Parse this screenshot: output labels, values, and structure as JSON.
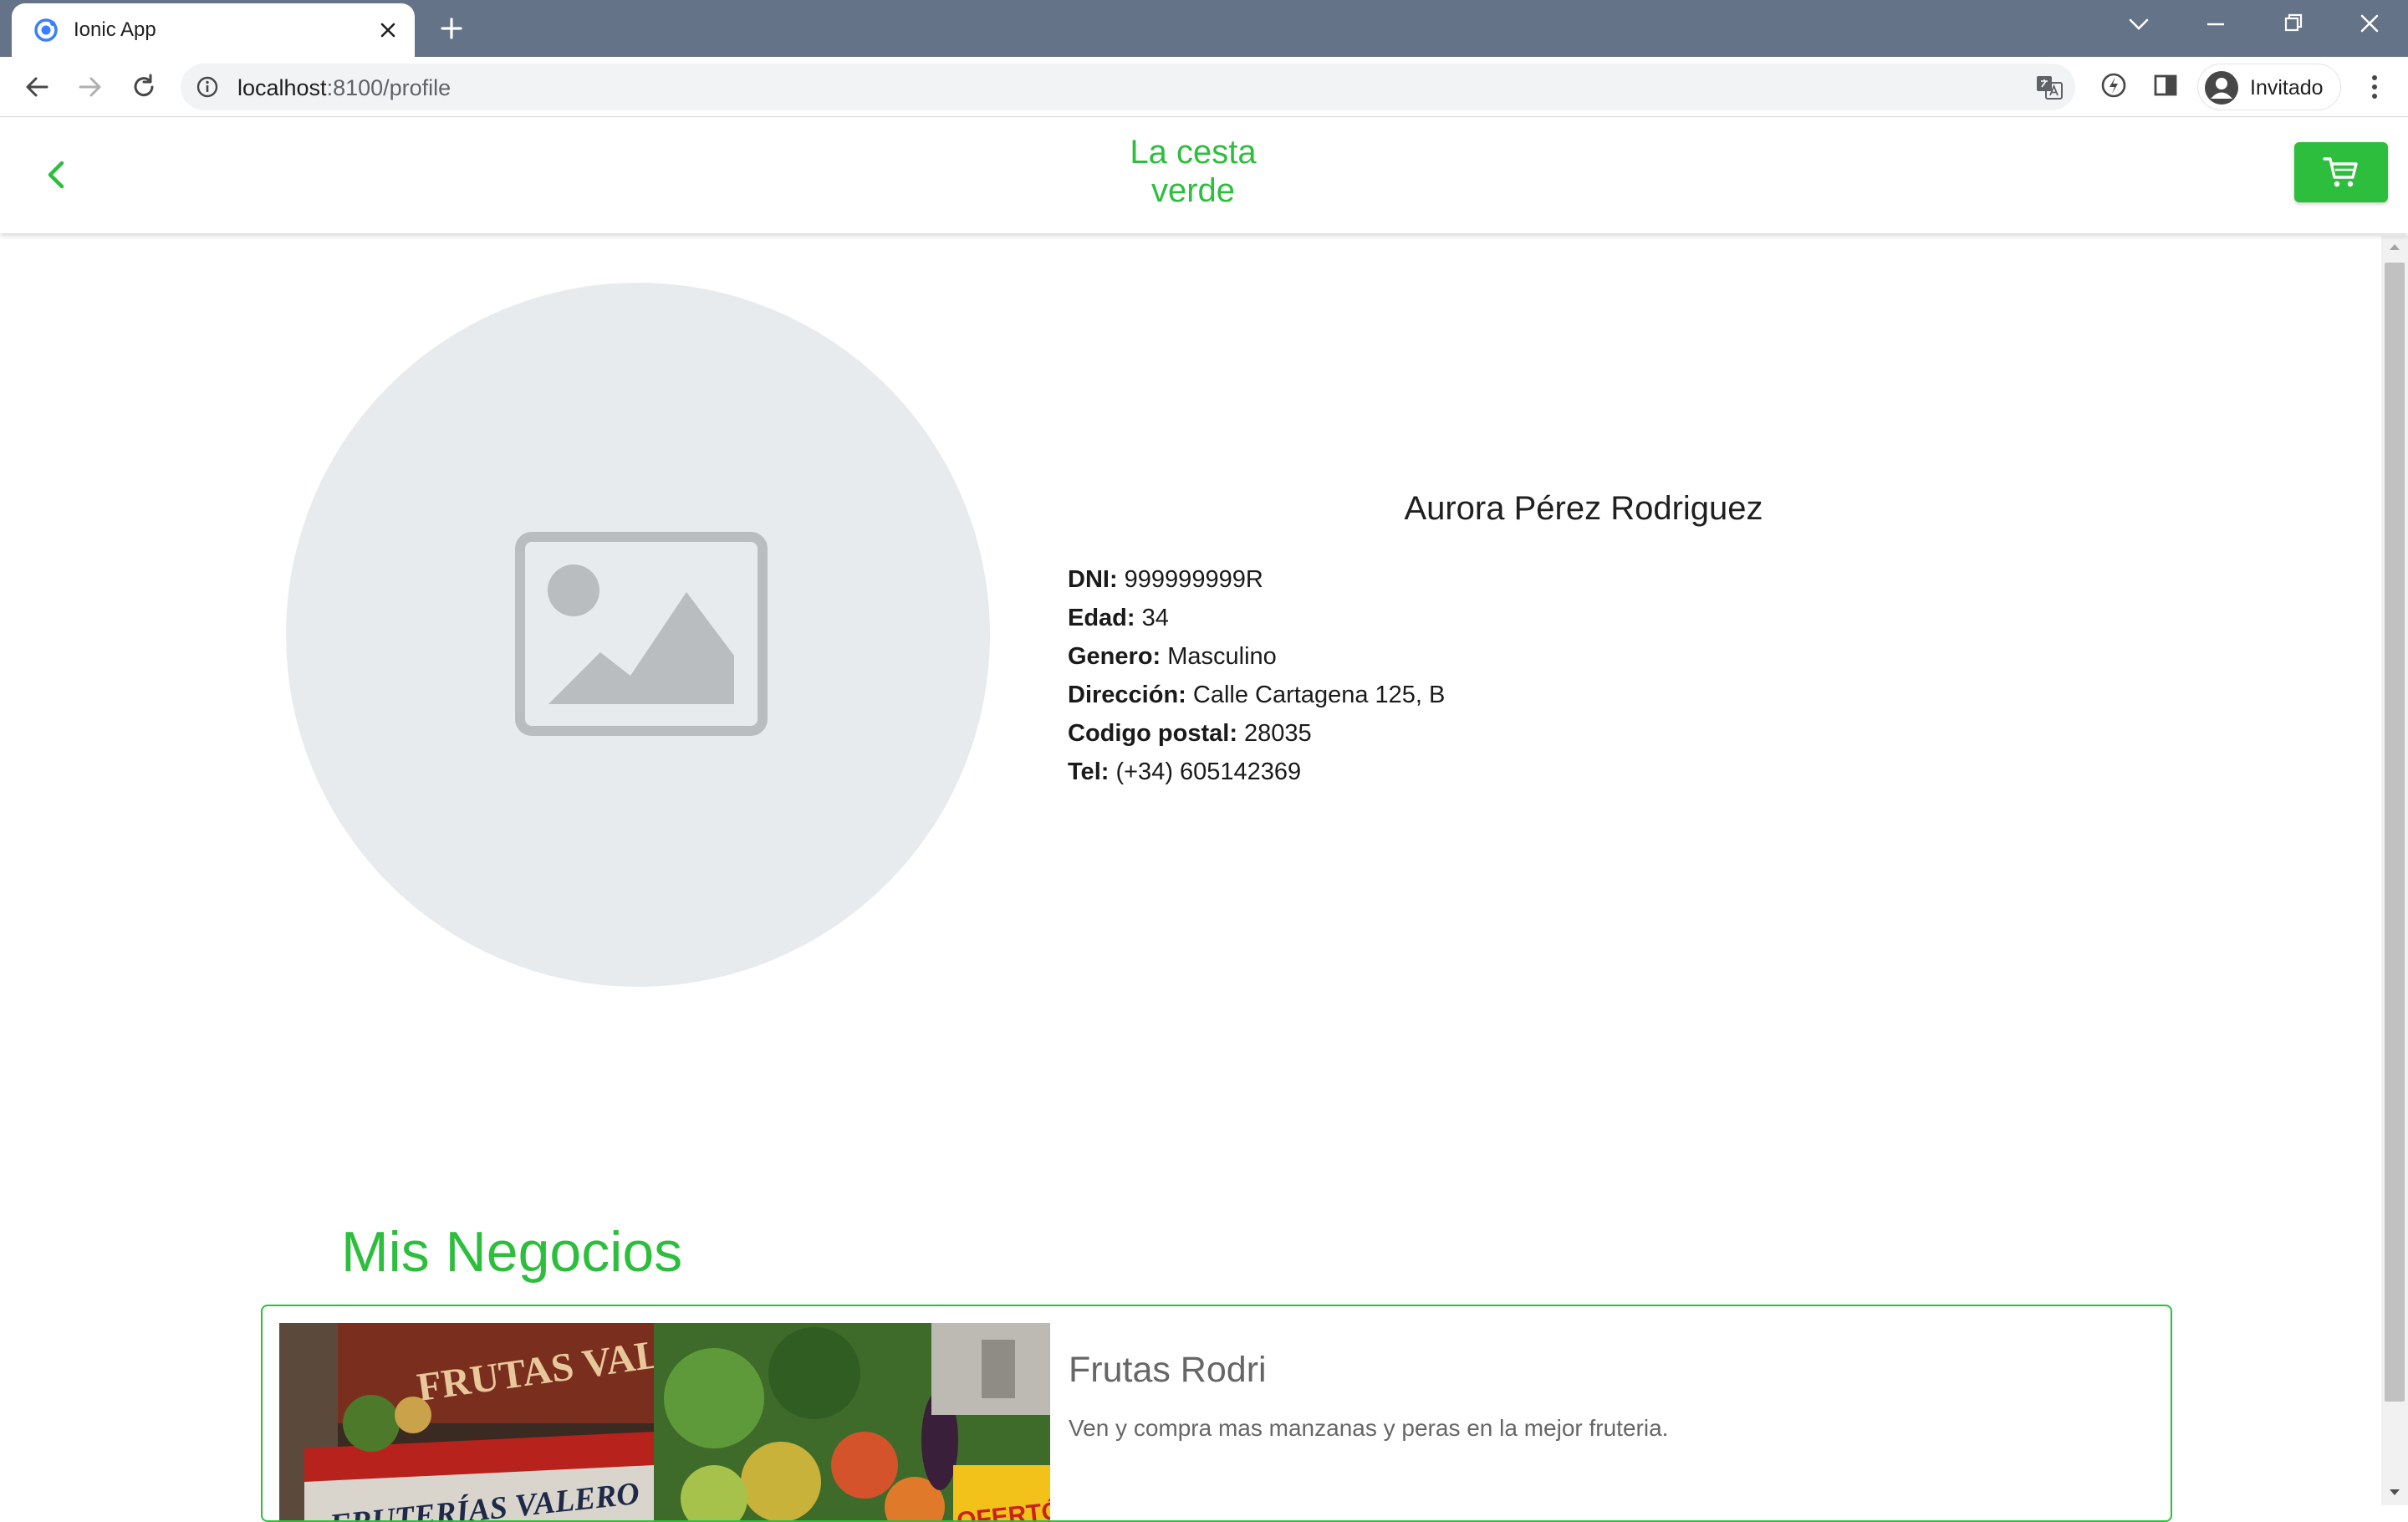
{
  "browser": {
    "tab_title": "Ionic App",
    "url_host": "localhost",
    "url_rest": ":8100/profile",
    "profile_label": "Invitado"
  },
  "app": {
    "title_line1": "La cesta",
    "title_line2": "verde",
    "accent_color": "#2dbe3e"
  },
  "profile": {
    "name": "Aurora Pérez Rodriguez",
    "fields": [
      {
        "label": "DNI:",
        "value": "999999999R"
      },
      {
        "label": "Edad:",
        "value": "34"
      },
      {
        "label": "Genero:",
        "value": "Masculino"
      },
      {
        "label": "Dirección:",
        "value": "Calle Cartagena 125, B"
      },
      {
        "label": "Codigo postal:",
        "value": "28035"
      },
      {
        "label": "Tel:",
        "value": "(+34) 605142369"
      }
    ]
  },
  "businesses": {
    "section_title": "Mis Negocios",
    "items": [
      {
        "name": "Frutas Rodri",
        "description": "Ven y compra mas manzanas y peras en la mejor fruteria.",
        "photo_sign_1": "FRUTAS VALERO",
        "photo_sign_2": "FRUTERÍAS VALERO",
        "photo_sign_3": "OFERTÓN!"
      }
    ]
  }
}
